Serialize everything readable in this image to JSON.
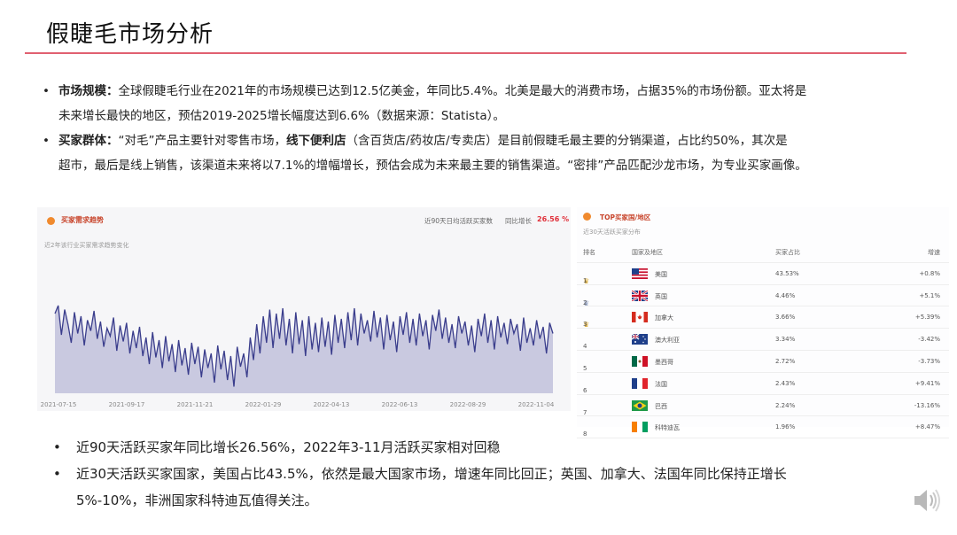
{
  "slide": {
    "title": "假睫毛市场分析",
    "top_bullets": [
      {
        "label": "市场规模：",
        "text": "全球假睫毛行业在2021年的市场规模已达到12.5亿美金，年同比5.4%。北美是最大的消费市场，占据35%的市场份额。亚太将是",
        "text2": "未来增长最快的地区，预估2019-2025增长幅度达到6.6%（数据来源：Statista）。"
      },
      {
        "label": "买家群体：",
        "text": "“对毛”产品主要针对零售市场，",
        "text_bold": "线下便利店",
        "text_rest": "（含百货店/药妆店/专卖店）是目前假睫毛最主要的分销渠道，占比约50%，其次是",
        "text2": "超市，最后是线上销售，该渠道未来将以7.1%的增幅增长，预估会成为未来最主要的销售渠道。“密排”产品匹配沙龙市场，为专业买家画像。"
      }
    ],
    "bottom_bullets": [
      {
        "text": "近90天活跃买家年同比增长26.56%，2022年3-11月活跃买家相对回稳"
      },
      {
        "text": "近30天活跃买家国家，美国占比43.5%，依然是最大国家市场，增速年同比回正；英国、加拿大、法国年同比保持正增长",
        "text2": "5%-10%，非洲国家科特迪瓦值得关注。"
      }
    ],
    "bullet_glyph": "•"
  },
  "trend_panel": {
    "title": "买家需求趋势",
    "subtitle": "近2年该行业买家需求趋势变化",
    "metric_label": "近90天日均活跃买家数",
    "yoy_label": "同比增长",
    "yoy_value": "26.56 %",
    "accent_color": "#f08a2e",
    "line_color": "#3a3d8c",
    "fill_color": "#c9c9e0"
  },
  "chart_data": {
    "type": "area",
    "title": "",
    "x_tick_labels": [
      "2021-07-15",
      "2021-09-17",
      "2021-11-21",
      "2022-01-29",
      "2022-04-13",
      "2022-06-13",
      "2022-08-29",
      "2022-11-04"
    ],
    "series": [
      {
        "values": [
          0.6,
          0.66,
          0.44,
          0.63,
          0.52,
          0.38,
          0.61,
          0.45,
          0.58,
          0.36,
          0.55,
          0.47,
          0.62,
          0.41,
          0.54,
          0.35,
          0.49,
          0.43,
          0.57,
          0.32,
          0.51,
          0.39,
          0.53,
          0.3,
          0.47,
          0.34,
          0.5,
          0.28,
          0.42,
          0.22,
          0.46,
          0.27,
          0.4,
          0.19,
          0.43,
          0.24,
          0.37,
          0.16,
          0.4,
          0.21,
          0.34,
          0.14,
          0.38,
          0.22,
          0.35,
          0.12,
          0.33,
          0.19,
          0.3,
          0.08,
          0.36,
          0.18,
          0.32,
          0.1,
          0.28,
          0.05,
          0.35,
          0.2,
          0.3,
          0.12,
          0.42,
          0.25,
          0.52,
          0.3,
          0.58,
          0.38,
          0.63,
          0.34,
          0.6,
          0.41,
          0.64,
          0.36,
          0.56,
          0.3,
          0.61,
          0.37,
          0.55,
          0.28,
          0.58,
          0.33,
          0.53,
          0.31,
          0.57,
          0.35,
          0.54,
          0.29,
          0.59,
          0.38,
          0.56,
          0.34,
          0.61,
          0.4,
          0.64,
          0.36,
          0.6,
          0.45,
          0.55,
          0.39,
          0.62,
          0.42,
          0.57,
          0.33,
          0.59,
          0.4,
          0.54,
          0.31,
          0.58,
          0.44,
          0.61,
          0.38,
          0.56,
          0.36,
          0.6,
          0.43,
          0.55,
          0.33,
          0.59,
          0.47,
          0.63,
          0.41,
          0.57,
          0.38,
          0.52,
          0.34,
          0.58,
          0.45,
          0.54,
          0.36,
          0.51,
          0.31,
          0.56,
          0.43,
          0.6,
          0.38,
          0.55,
          0.33,
          0.58,
          0.42,
          0.53,
          0.37,
          0.56,
          0.45,
          0.52,
          0.32,
          0.57,
          0.38,
          0.49,
          0.36,
          0.55,
          0.41,
          0.5,
          0.3,
          0.53,
          0.45
        ]
      }
    ],
    "ylim": [
      0,
      1
    ]
  },
  "country_panel": {
    "title": "TOP买家国/地区",
    "subtitle": "近30天活跃买家分布",
    "headers": {
      "rank": "排名",
      "country": "国家及地区",
      "share": "买家占比",
      "growth": "增速"
    },
    "crown_glyph": "♛",
    "rows": [
      {
        "rank": "1",
        "crown": "gold",
        "flag": "us",
        "country": "美国",
        "share": "43.53%",
        "growth": "+0.8%"
      },
      {
        "rank": "2",
        "crown": "silver",
        "flag": "gb",
        "country": "英国",
        "share": "4.46%",
        "growth": "+5.1%"
      },
      {
        "rank": "3",
        "crown": "gold",
        "flag": "ca",
        "country": "加拿大",
        "share": "3.66%",
        "growth": "+5.39%"
      },
      {
        "rank": "4",
        "crown": "",
        "flag": "au",
        "country": "澳大利亚",
        "share": "3.34%",
        "growth": "-3.42%"
      },
      {
        "rank": "5",
        "crown": "",
        "flag": "mx",
        "country": "墨西哥",
        "share": "2.72%",
        "growth": "-3.73%"
      },
      {
        "rank": "6",
        "crown": "",
        "flag": "fr",
        "country": "法国",
        "share": "2.43%",
        "growth": "+9.41%"
      },
      {
        "rank": "7",
        "crown": "",
        "flag": "br",
        "country": "巴西",
        "share": "2.24%",
        "growth": "-13.16%"
      },
      {
        "rank": "8",
        "crown": "",
        "flag": "ci",
        "country": "科特迪瓦",
        "share": "1.96%",
        "growth": "+8.47%"
      }
    ]
  },
  "controls": {
    "audio_icon": "speaker-icon"
  }
}
